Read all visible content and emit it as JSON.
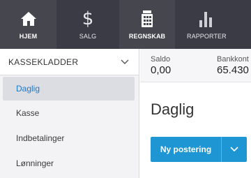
{
  "topnav": {
    "items": [
      {
        "label": "HJEM",
        "icon": "home-icon",
        "active": true
      },
      {
        "label": "SALG",
        "icon": "dollar-icon",
        "active": false
      },
      {
        "label": "REGNSKAB",
        "icon": "calculator-icon",
        "active": true
      },
      {
        "label": "RAPPORTER",
        "icon": "bar-chart-icon",
        "active": false
      }
    ]
  },
  "sidebar": {
    "section_title": "KASSEKLADDER",
    "items": [
      {
        "label": "Daglig",
        "active": true
      },
      {
        "label": "Kasse",
        "active": false
      },
      {
        "label": "Indbetalinger",
        "active": false
      },
      {
        "label": "Lønninger",
        "active": false
      }
    ]
  },
  "stats": {
    "saldo_label": "Saldo",
    "saldo_value": "0,00",
    "bank_label": "Bankkont",
    "bank_value": "65.430"
  },
  "main": {
    "title": "Daglig",
    "new_entry_label": "Ny postering"
  },
  "colors": {
    "nav_bg": "#3b3b45",
    "accent": "#1e96d4",
    "active_link": "#1f78c8"
  }
}
